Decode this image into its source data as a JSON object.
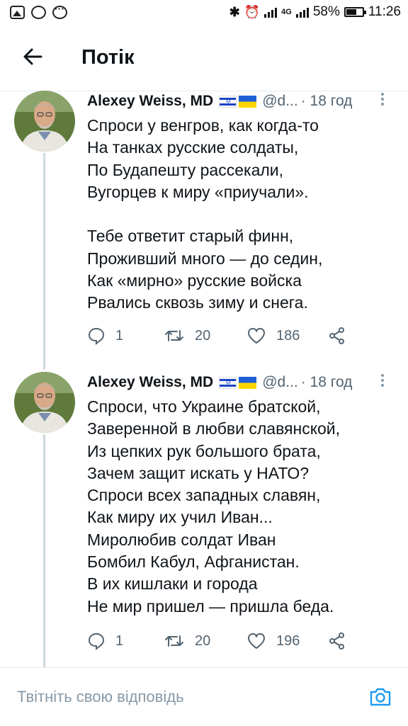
{
  "status_bar": {
    "battery": "58%",
    "battery_level": 0.58,
    "network": "4G",
    "time": "11:26"
  },
  "header": {
    "title": "Потік"
  },
  "tweets": [
    {
      "name": "Alexey Weiss, MD",
      "handle": "@d...",
      "time": "· 18 год",
      "text": "Спроси у венгров, как когда-то\nНа танках русские солдаты,\nПо Будапешту рассекали,\nВугорцев к миру «приучали».\n\nТебе ответит старый финн,\nПроживший много — до седин,\nКак «мирно» русские войска\nРвались сквозь зиму и снега.",
      "replies": "1",
      "retweets": "20",
      "likes": "186"
    },
    {
      "name": "Alexey Weiss, MD",
      "handle": "@d...",
      "time": "· 18 год",
      "text": "Спроси, что Украине братской,\nЗаверенной в любви славянской,\nИз цепких рук большого брата,\nЗачем защит искать у НАТО?\nСпроси всех западных славян,\nКак миру их учил Иван...\nМиролюбив солдат Иван\nБомбил Кабул, Афганистан.\nВ их кишлаки и города\nНе мир пришел — пришла беда.",
      "replies": "1",
      "retweets": "20",
      "likes": "196"
    }
  ],
  "reply_bar": {
    "placeholder": "Твітніть свою відповідь"
  },
  "colors": {
    "text_primary": "#0f1419",
    "text_secondary": "#536471",
    "accent": "#1d9bf0",
    "divider": "#e6ecf0"
  }
}
